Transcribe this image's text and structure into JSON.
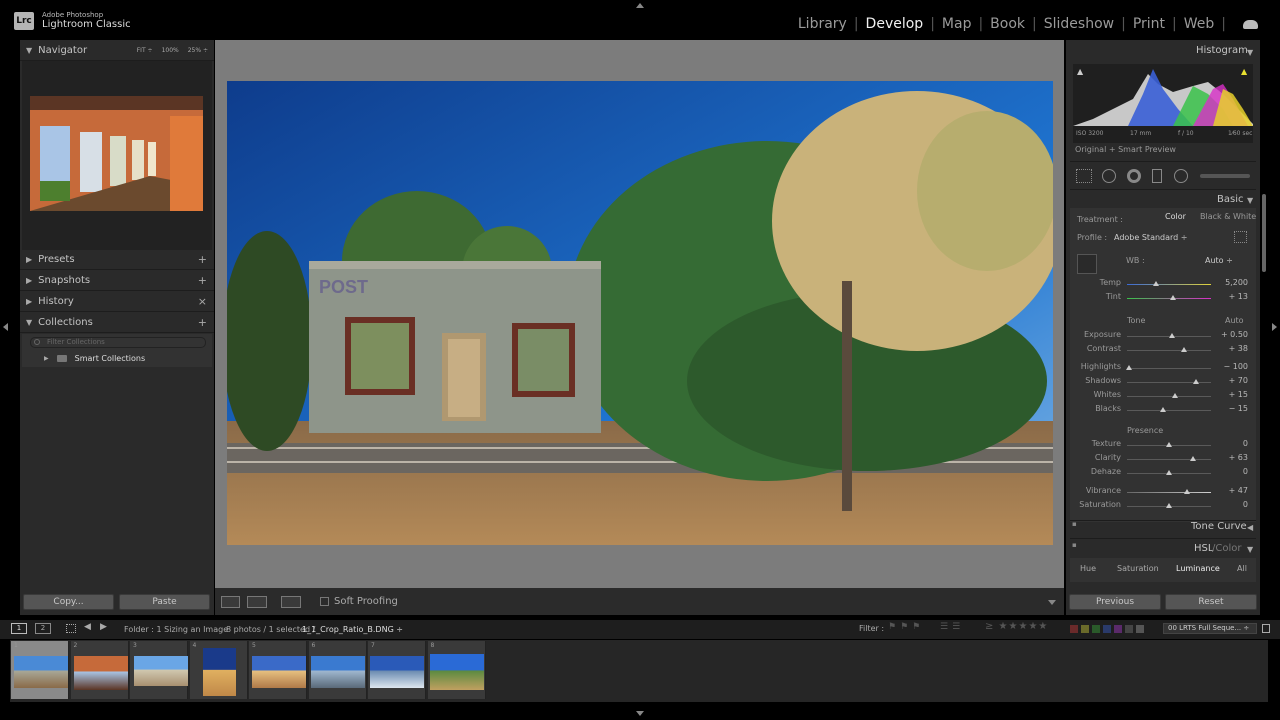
{
  "app": {
    "badge": "Lrc",
    "brand_line1": "Adobe Photoshop",
    "brand_line2": "Lightroom Classic"
  },
  "modules": [
    {
      "label": "Library",
      "active": false
    },
    {
      "label": "Develop",
      "active": true
    },
    {
      "label": "Map",
      "active": false
    },
    {
      "label": "Book",
      "active": false
    },
    {
      "label": "Slideshow",
      "active": false
    },
    {
      "label": "Print",
      "active": false
    },
    {
      "label": "Web",
      "active": false
    }
  ],
  "left": {
    "navigator": {
      "title": "Navigator",
      "fit": "FIT ÷",
      "zoom1": "100%",
      "zoom2": "25% ÷"
    },
    "presets": "Presets",
    "snapshots": "Snapshots",
    "history": "History",
    "collections": "Collections",
    "filter_placeholder": "Filter Collections",
    "smart_collections": "Smart Collections",
    "copy_button": "Copy...",
    "paste_button": "Paste"
  },
  "toolbar": {
    "soft_proofing": "Soft Proofing"
  },
  "right": {
    "histogram": {
      "title": "Histogram",
      "iso": "ISO 3200",
      "focal": "17 mm",
      "aperture": "f / 10",
      "shutter": "1⁄60 sec",
      "preview_label": "Original + Smart Preview"
    },
    "basic": {
      "title": "Basic",
      "treatment_label": "Treatment :",
      "treatment_color": "Color",
      "treatment_bw": "Black & White",
      "profile_label": "Profile :",
      "profile_value": "Adobe Standard ÷",
      "wb_label": "WB :",
      "wb_value": "Auto ÷",
      "tone_label": "Tone",
      "tone_auto": "Auto",
      "presence_label": "Presence",
      "sliders": [
        {
          "label": "Temp",
          "value": "5,200",
          "pos": 0.35
        },
        {
          "label": "Tint",
          "value": "+ 13",
          "pos": 0.55
        },
        {
          "label": "Exposure",
          "value": "+ 0.50",
          "pos": 0.53
        },
        {
          "label": "Contrast",
          "value": "+ 38",
          "pos": 0.68
        },
        {
          "label": "Highlights",
          "value": "− 100",
          "pos": 0.02
        },
        {
          "label": "Shadows",
          "value": "+ 70",
          "pos": 0.82
        },
        {
          "label": "Whites",
          "value": "+ 15",
          "pos": 0.57
        },
        {
          "label": "Blacks",
          "value": "− 15",
          "pos": 0.43
        },
        {
          "label": "Texture",
          "value": "0",
          "pos": 0.5
        },
        {
          "label": "Clarity",
          "value": "+ 63",
          "pos": 0.79
        },
        {
          "label": "Dehaze",
          "value": "0",
          "pos": 0.5
        },
        {
          "label": "Vibrance",
          "value": "+ 47",
          "pos": 0.72
        },
        {
          "label": "Saturation",
          "value": "0",
          "pos": 0.5
        }
      ]
    },
    "tone_curve": "Tone Curve",
    "hsl_title": "HSL",
    "hsl_color": "Color",
    "hsl_tabs": [
      "Hue",
      "Saturation",
      "Luminance",
      "All"
    ],
    "previous_button": "Previous",
    "reset_button": "Reset"
  },
  "filmbar": {
    "view1": "1",
    "view2": "2",
    "folder_text": "Folder : 1 Sizing an Image",
    "photo_count": "8 photos / 1 selected /",
    "filename": "1_1_Crop_Ratio_B.DNG ÷",
    "filter_label": "Filter :",
    "preset_select": "00 LRTS Full Seque... ÷"
  },
  "thumbnails": [
    {
      "num": "1",
      "selected": true
    },
    {
      "num": "2",
      "selected": false
    },
    {
      "num": "3",
      "selected": false
    },
    {
      "num": "4",
      "selected": false
    },
    {
      "num": "5",
      "selected": false
    },
    {
      "num": "6",
      "selected": false
    },
    {
      "num": "7",
      "selected": false
    },
    {
      "num": "8",
      "selected": false
    }
  ],
  "colors": {
    "panel": "#2a2a2a",
    "center_bg": "#7c7c7c",
    "active_module": "#f2f2f2"
  }
}
